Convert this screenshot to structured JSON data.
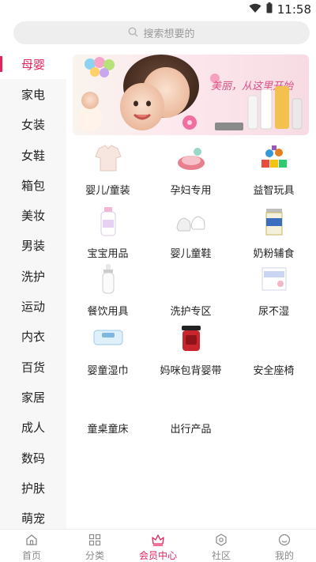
{
  "status_bar": {
    "time": "11:58"
  },
  "search": {
    "placeholder": "搜索想要的"
  },
  "sidebar": {
    "items": [
      {
        "label": "母婴",
        "active": true
      },
      {
        "label": "家电"
      },
      {
        "label": "女装"
      },
      {
        "label": "女鞋"
      },
      {
        "label": "箱包"
      },
      {
        "label": "美妆"
      },
      {
        "label": "男装"
      },
      {
        "label": "洗护"
      },
      {
        "label": "运动"
      },
      {
        "label": "内衣"
      },
      {
        "label": "百货"
      },
      {
        "label": "家居"
      },
      {
        "label": "成人"
      },
      {
        "label": "数码"
      },
      {
        "label": "护肤"
      },
      {
        "label": "萌宠"
      }
    ]
  },
  "banner": {
    "script_text": "美丽，从这里开始"
  },
  "categories": [
    {
      "label": "婴儿/童装",
      "icon": "baby-clothes-icon"
    },
    {
      "label": "孕妇专用",
      "icon": "maternity-icon"
    },
    {
      "label": "益智玩具",
      "icon": "toy-blocks-icon"
    },
    {
      "label": "宝宝用品",
      "icon": "baby-lotion-icon"
    },
    {
      "label": "婴儿童鞋",
      "icon": "baby-shoes-icon"
    },
    {
      "label": "奶粉辅食",
      "icon": "milk-powder-icon"
    },
    {
      "label": "餐饮用具",
      "icon": "feeding-bottle-icon"
    },
    {
      "label": "洗护专区",
      "icon": "wash-care-icon"
    },
    {
      "label": "尿不湿",
      "icon": "diaper-icon"
    },
    {
      "label": "婴童湿巾",
      "icon": "wet-wipes-icon"
    },
    {
      "label": "妈咪包背婴带",
      "icon": "baby-carrier-icon"
    },
    {
      "label": "安全座椅",
      "icon": ""
    },
    {
      "label": "童桌童床",
      "icon": ""
    },
    {
      "label": "出行产品",
      "icon": ""
    }
  ],
  "bottom_nav": {
    "items": [
      {
        "label": "首页",
        "icon": "home-icon"
      },
      {
        "label": "分类",
        "icon": "grid-icon"
      },
      {
        "label": "会员中心",
        "icon": "crown-icon",
        "active": true
      },
      {
        "label": "社区",
        "icon": "hexagon-icon"
      },
      {
        "label": "我的",
        "icon": "face-icon"
      }
    ]
  },
  "colors": {
    "accent": "#e0245e",
    "sidebar_bg": "#f7f7f7",
    "search_bg": "#eeeeee"
  }
}
